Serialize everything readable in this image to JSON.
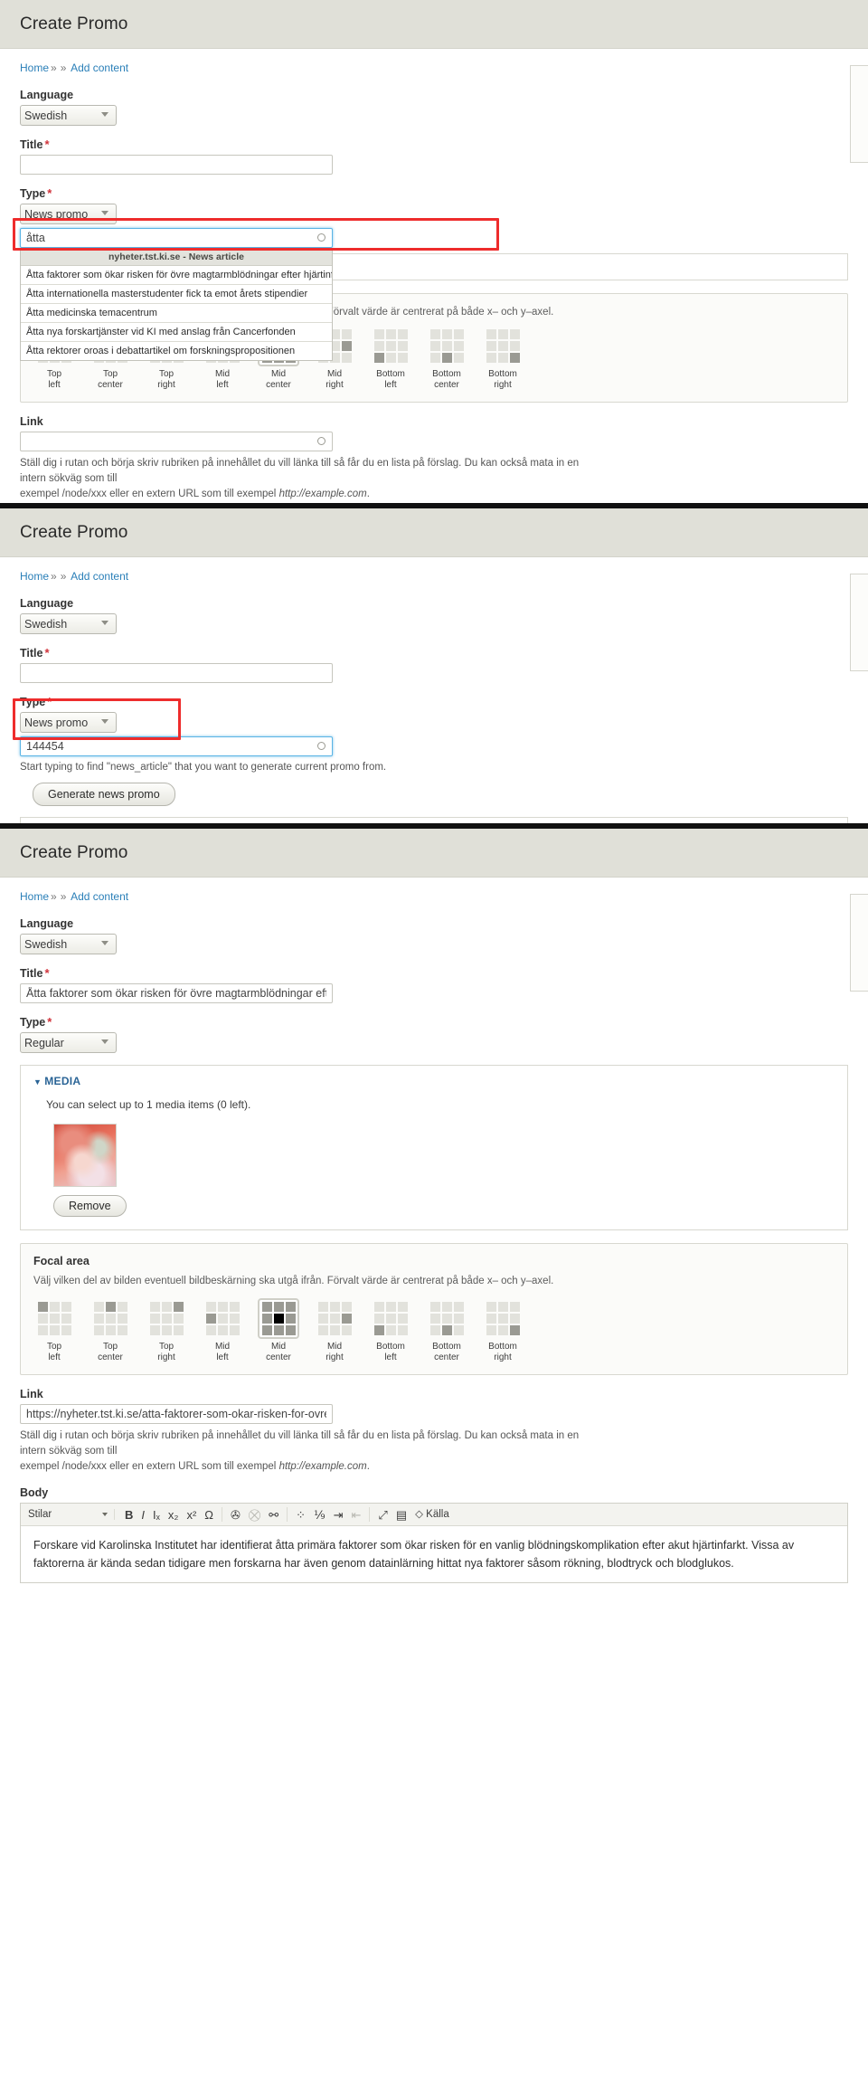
{
  "app": {
    "title": "Create Promo",
    "breadcrumb": {
      "home": "Home",
      "sep1": "»",
      "sep2": "»",
      "add": "Add content"
    }
  },
  "labels": {
    "language": "Language",
    "title": "Title",
    "type": "Type",
    "link": "Link",
    "body": "Body",
    "required_mark": "*",
    "focal_area": "Focal area",
    "media_toggle": "MEDIA",
    "media_arrow_open": "▼",
    "media_arrow_closed": "►"
  },
  "options": {
    "language_selected": "Swedish",
    "type_news_promo": "News promo",
    "type_regular": "Regular"
  },
  "focal": {
    "hint": "Välj vilken del av bilden eventuell bildbeskärning ska utgå ifrån. Förvalt värde är centrerat på både x– och y–axel.",
    "cells": [
      {
        "label_line1": "Top",
        "label_line2": "left"
      },
      {
        "label_line1": "Top",
        "label_line2": "center"
      },
      {
        "label_line1": "Top",
        "label_line2": "right"
      },
      {
        "label_line1": "Mid",
        "label_line2": "left"
      },
      {
        "label_line1": "Mid",
        "label_line2": "center"
      },
      {
        "label_line1": "Mid",
        "label_line2": "right"
      },
      {
        "label_line1": "Bottom",
        "label_line2": "left"
      },
      {
        "label_line1": "Bottom",
        "label_line2": "center"
      },
      {
        "label_line1": "Bottom",
        "label_line2": "right"
      }
    ],
    "selected_index": 4
  },
  "link_help": {
    "line1": "Ställ dig i rutan och börja skriv rubriken på innehållet du vill länka till så får du en lista på förslag. Du kan också mata in en intern sökväg som till",
    "line2_a": "exempel /node/xxx eller en extern URL som till exempel ",
    "line2_em": "http://example.com",
    "line2_b": "."
  },
  "editor": {
    "styles_label": "Stilar",
    "buttons": [
      {
        "name": "bold",
        "glyph": "B"
      },
      {
        "name": "italic",
        "glyph": "I"
      },
      {
        "name": "remove-format",
        "glyph": "Iₓ"
      },
      {
        "name": "subscript",
        "glyph": "x₂"
      },
      {
        "name": "superscript",
        "glyph": "x²"
      },
      {
        "name": "special-char",
        "glyph": "Ω"
      },
      {
        "name": "link",
        "glyph": "✇"
      },
      {
        "name": "unlink",
        "glyph": "⛒"
      },
      {
        "name": "anchor",
        "glyph": "⚯"
      },
      {
        "name": "bullet-list",
        "glyph": "⁘"
      },
      {
        "name": "numbered-list",
        "glyph": "⅑"
      },
      {
        "name": "indent",
        "glyph": "⇥"
      },
      {
        "name": "outdent",
        "glyph": "⇤"
      },
      {
        "name": "maximize",
        "glyph": "⤢"
      },
      {
        "name": "show-blocks",
        "glyph": "▤"
      },
      {
        "name": "source",
        "glyph": "◇"
      }
    ],
    "source_label": "Källa"
  },
  "panel1": {
    "title_value": "",
    "autocomplete_value": "åtta",
    "autocomplete_group": "nyheter.tst.ki.se - News article",
    "suggestions": [
      "Åtta faktorer som ökar risken för övre magtarmblödningar efter hjärtinfarkt",
      "Åtta internationella masterstudenter fick ta emot årets stipendier",
      "Åtta medicinska temacentrum",
      "Åtta nya forskartjänster vid KI med anslag från Cancerfonden",
      "Åtta rektorer oroas i debattartikel om forskningspropositionen"
    ],
    "link_value": ""
  },
  "panel2": {
    "title_value": "",
    "autocomplete_value": "144454",
    "autocomplete_help": "Start typing to find \"news_article\" that you want to generate current promo from.",
    "generate_button": "Generate news promo"
  },
  "panel3": {
    "title_value": "Åtta faktorer som ökar risken för övre magtarmblödningar efter hjärtinfarkt",
    "type_value": "Regular",
    "media_note": "You can select up to 1 media items (0 left).",
    "remove_button": "Remove",
    "link_value": "https://nyheter.tst.ki.se/atta-faktorer-som-okar-risken-for-ovre-magtarmbl",
    "body_text": "Forskare vid Karolinska Institutet har identifierat åtta primära faktorer som ökar risken för en vanlig blödningskomplikation efter akut hjärtinfarkt. Vissa av faktorerna är kända sedan tidigare men forskarna har även genom datainlärning hittat nya faktorer såsom rökning, blodtryck och blodglukos."
  },
  "colors": {
    "highlight": "#ee2c2c",
    "header_bg": "#e0e0d8",
    "link": "#2a7fb8",
    "required": "#d0323a"
  }
}
